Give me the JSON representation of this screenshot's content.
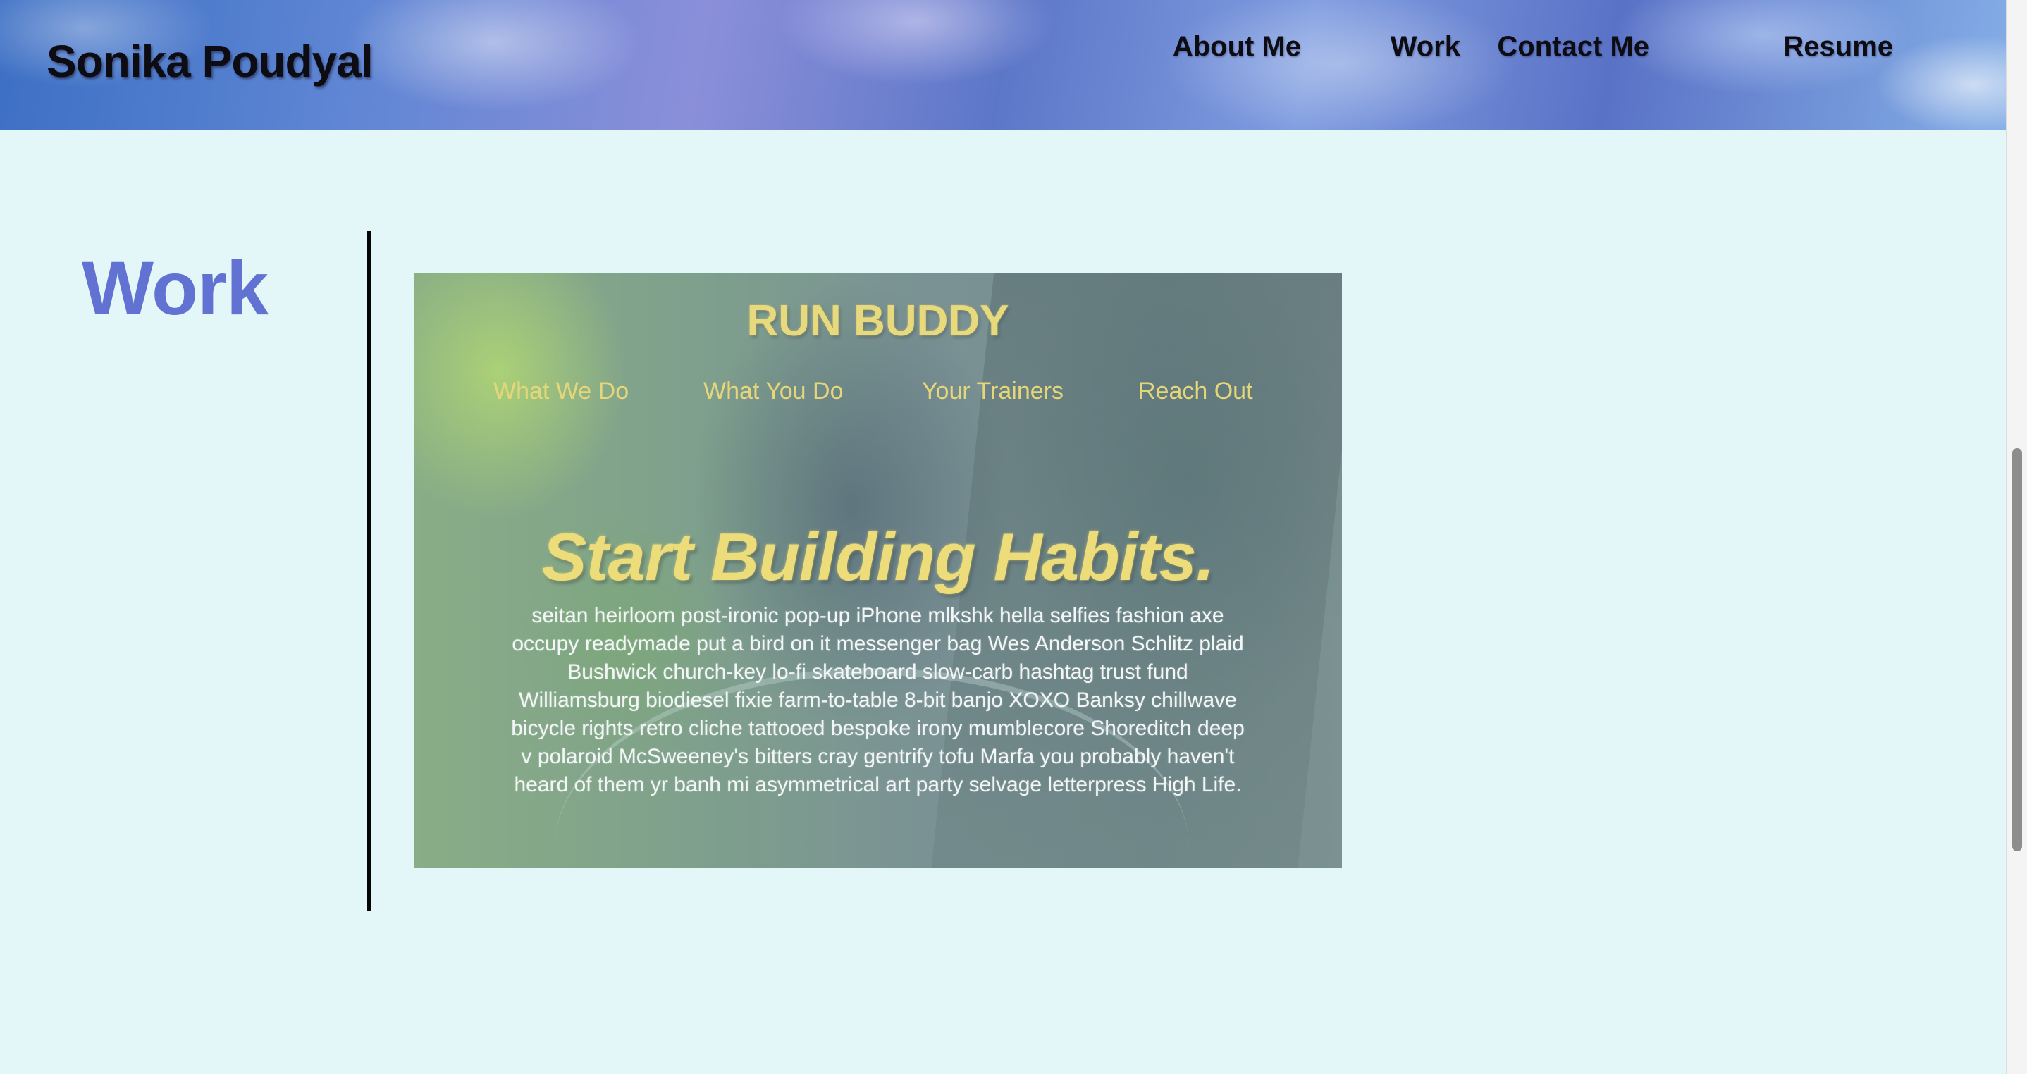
{
  "header": {
    "site_name": "Sonika Poudyal",
    "nav": [
      {
        "label": "About Me"
      },
      {
        "label": "Work"
      },
      {
        "label": "Contact Me"
      },
      {
        "label": "Resume"
      }
    ]
  },
  "work": {
    "title": "Work",
    "project": {
      "brand": "RUN BUDDY",
      "nav": [
        "What We Do",
        "What You Do",
        "Your Trainers",
        "Reach Out"
      ],
      "headline": "Start Building Habits.",
      "body": "seitan heirloom post-ironic pop-up iPhone mlkshk hella selfies fashion axe occupy readymade put a bird on it messenger bag Wes Anderson Schlitz plaid Bushwick church-key lo-fi skateboard slow-carb hashtag trust fund Williamsburg biodiesel fixie farm-to-table 8-bit banjo XOXO Banksy chillwave bicycle rights retro cliche tattooed bespoke irony mumblecore Shoreditch deep v polaroid McSweeney's bitters cray gentrify tofu Marfa you probably haven't heard of them yr banh mi asymmetrical art party selvage letterpress High Life."
    }
  },
  "colors": {
    "page_background": "#e3f7f9",
    "section_title": "#6272d2",
    "project_accent": "#e8da7c"
  }
}
